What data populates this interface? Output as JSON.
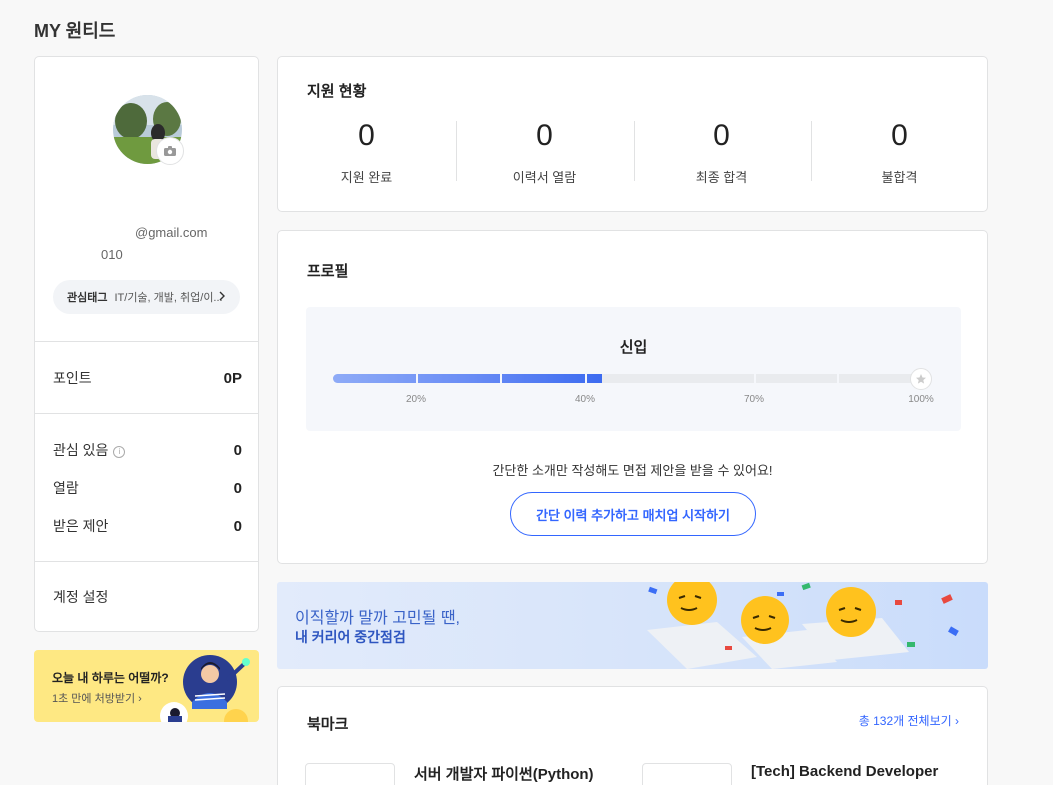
{
  "page_title": "MY 원티드",
  "profile": {
    "email": "@gmail.com",
    "phone": "010",
    "interest_tag_title": "관심태그",
    "interest_tag_value": "IT/기술, 개발, 취업/이..."
  },
  "left_rows": {
    "points_label": "포인트",
    "points_value": "0P",
    "interested_label": "관심 있음",
    "interested_value": "0",
    "viewed_label": "열람",
    "viewed_value": "0",
    "offers_label": "받은 제안",
    "offers_value": "0",
    "account_settings": "계정 설정"
  },
  "yellow_banner": {
    "title": "오늘 내 하루는 어떨까?",
    "subtitle": "1초 만에 처방받기"
  },
  "status": {
    "title": "지원 현황",
    "stats": [
      {
        "value": "0",
        "label": "지원 완료"
      },
      {
        "value": "0",
        "label": "이력서 열람"
      },
      {
        "value": "0",
        "label": "최종 합격"
      },
      {
        "value": "0",
        "label": "불합격"
      }
    ]
  },
  "profile_section": {
    "title": "프로필",
    "level": "신입",
    "progress_fraction": 0.45,
    "ticks": [
      "20%",
      "40%",
      "70%",
      "100%"
    ],
    "message": "간단한 소개만 작성해도 면접 제안을 받을 수 있어요!",
    "button": "간단 이력 추가하고 매치업 시작하기"
  },
  "blue_banner": {
    "line1": "이직할까 말까 고민될 땐,",
    "line2": "내 커리어 중간점검"
  },
  "bookmark": {
    "title": "북마크",
    "view_all": "총 132개 전체보기",
    "items": [
      {
        "title": "서버 개발자 파이썬(Python)"
      },
      {
        "title": "[Tech] Backend Developer"
      }
    ]
  },
  "colors": {
    "accent": "#3366ff",
    "yellow_banner": "#fee883",
    "blue_banner": "#d5e3fa"
  }
}
